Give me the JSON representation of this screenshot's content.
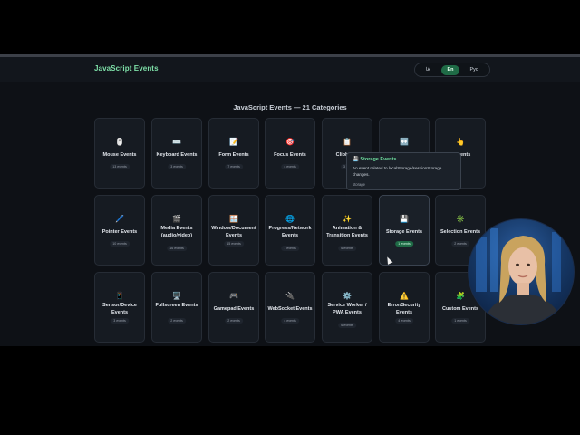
{
  "header": {
    "brand": "JavaScript Events",
    "languages": [
      {
        "label": "فا",
        "active": false
      },
      {
        "label": "En",
        "active": true
      },
      {
        "label": "Рус",
        "active": false
      }
    ]
  },
  "main": {
    "title": "JavaScript Events — 21 Categories",
    "cards": [
      {
        "icon": "🖱️",
        "icon_name": "mouse-icon",
        "name": "Mouse Events",
        "count": "13 events"
      },
      {
        "icon": "⌨️",
        "icon_name": "keyboard-icon",
        "name": "Keyboard Events",
        "count": "3 events"
      },
      {
        "icon": "📝",
        "icon_name": "form-icon",
        "name": "Form Events",
        "count": "7 events"
      },
      {
        "icon": "🎯",
        "icon_name": "focus-target-icon",
        "name": "Focus Events",
        "count": "4 events"
      },
      {
        "icon": "📋",
        "icon_name": "clipboard-icon",
        "name": "Clipboa...",
        "count": "3 e..."
      },
      {
        "icon": "↔️",
        "icon_name": "drag-drop-icon",
        "name": "",
        "count": ""
      },
      {
        "icon": "👆",
        "icon_name": "touch-icon",
        "name": "...Events",
        "count": ""
      },
      {
        "icon": "🖊️",
        "icon_name": "pointer-pen-icon",
        "name": "Pointer Events",
        "count": "10 events"
      },
      {
        "icon": "🎬",
        "icon_name": "media-clapper-icon",
        "name": "Media Events (audio/video)",
        "count": "16 events"
      },
      {
        "icon": "🪟",
        "icon_name": "window-icon",
        "name": "Window/Document Events",
        "count": "15 events"
      },
      {
        "icon": "🌐",
        "icon_name": "globe-network-icon",
        "name": "Progress/Network Events",
        "count": "7 events"
      },
      {
        "icon": "✨",
        "icon_name": "sparkles-icon",
        "name": "Animation & Transition Events",
        "count": "6 events"
      },
      {
        "icon": "💾",
        "icon_name": "floppy-disk-icon",
        "name": "Storage Events",
        "count": "1 events",
        "active": true
      },
      {
        "icon": "✳️",
        "icon_name": "selection-icon",
        "name": "Selection Events",
        "count": "2 events"
      },
      {
        "icon": "📱",
        "icon_name": "mobile-sensor-icon",
        "name": "Sensor/Device Events",
        "count": "3 events"
      },
      {
        "icon": "🖥️",
        "icon_name": "monitor-icon",
        "name": "Fullscreen Events",
        "count": "2 events"
      },
      {
        "icon": "🎮",
        "icon_name": "gamepad-icon",
        "name": "Gamepad Events",
        "count": "2 events"
      },
      {
        "icon": "🔌",
        "icon_name": "plug-icon",
        "name": "WebSocket Events",
        "count": "4 events"
      },
      {
        "icon": "⚙️",
        "icon_name": "gear-icon",
        "name": "Service Worker / PWA Events",
        "count": "6 events"
      },
      {
        "icon": "⚠️",
        "icon_name": "warning-icon",
        "name": "Error/Security Events",
        "count": "4 events"
      },
      {
        "icon": "🧩",
        "icon_name": "puzzle-icon",
        "name": "Custom Events",
        "count": "1 events"
      }
    ]
  },
  "tooltip": {
    "icon": "💾",
    "title": "Storage Events",
    "description": "An event related to localStorage/sessionStorage changes.",
    "tag": "storage"
  },
  "colors": {
    "accent": "#7ee0a8",
    "active_lang_bg": "#1f6b46",
    "page_bg": "#0e1116",
    "card_bg": "#161b22"
  }
}
